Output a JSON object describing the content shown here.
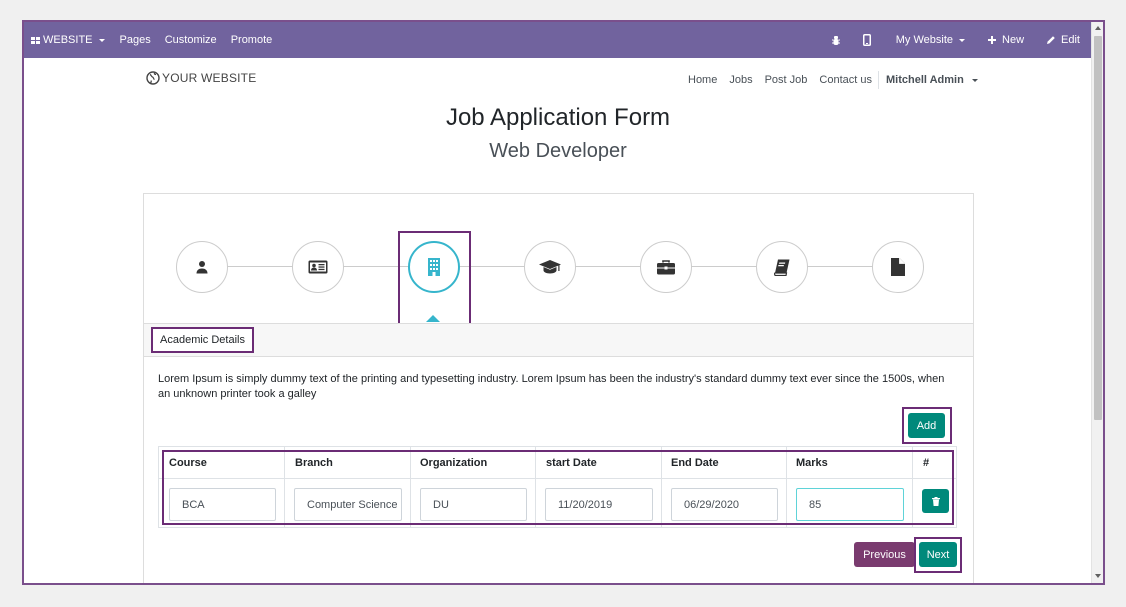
{
  "topbar": {
    "brand": "WEBSITE",
    "items": [
      "Pages",
      "Customize",
      "Promote"
    ],
    "website_switcher": "My Website",
    "new_label": "New",
    "edit_label": "Edit"
  },
  "site": {
    "logo_text": "YOUR WEBSITE",
    "menu": [
      "Home",
      "Jobs",
      "Post Job",
      "Contact us"
    ],
    "user": "Mitchell Admin"
  },
  "page": {
    "title": "Job Application Form",
    "subtitle": "Web Developer"
  },
  "steps": [
    {
      "icon": "user-icon",
      "active": false
    },
    {
      "icon": "id-card-icon",
      "active": false
    },
    {
      "icon": "building-icon",
      "active": true
    },
    {
      "icon": "graduation-cap-icon",
      "active": false
    },
    {
      "icon": "briefcase-icon",
      "active": false
    },
    {
      "icon": "book-icon",
      "active": false
    },
    {
      "icon": "file-icon",
      "active": false
    }
  ],
  "section": {
    "label": "Academic Details",
    "description": "Lorem Ipsum is simply dummy text of the printing and typesetting industry. Lorem Ipsum has been the industry's standard dummy text ever since the 1500s, when an unknown printer took a galley"
  },
  "buttons": {
    "add": "Add",
    "previous": "Previous",
    "next": "Next"
  },
  "table": {
    "headers": [
      "Course",
      "Branch",
      "Organization",
      "start Date",
      "End Date",
      "Marks",
      "#"
    ],
    "row": {
      "course": "BCA",
      "branch": "Computer Science",
      "organization": "DU",
      "start_date": "11/20/2019",
      "end_date": "06/29/2020",
      "marks": "85"
    }
  },
  "colors": {
    "topbar": "#71639e",
    "accent": "#00897b",
    "previous": "#7a3b6f",
    "active_step": "#36b5cc",
    "highlight": "#6b2c75"
  }
}
